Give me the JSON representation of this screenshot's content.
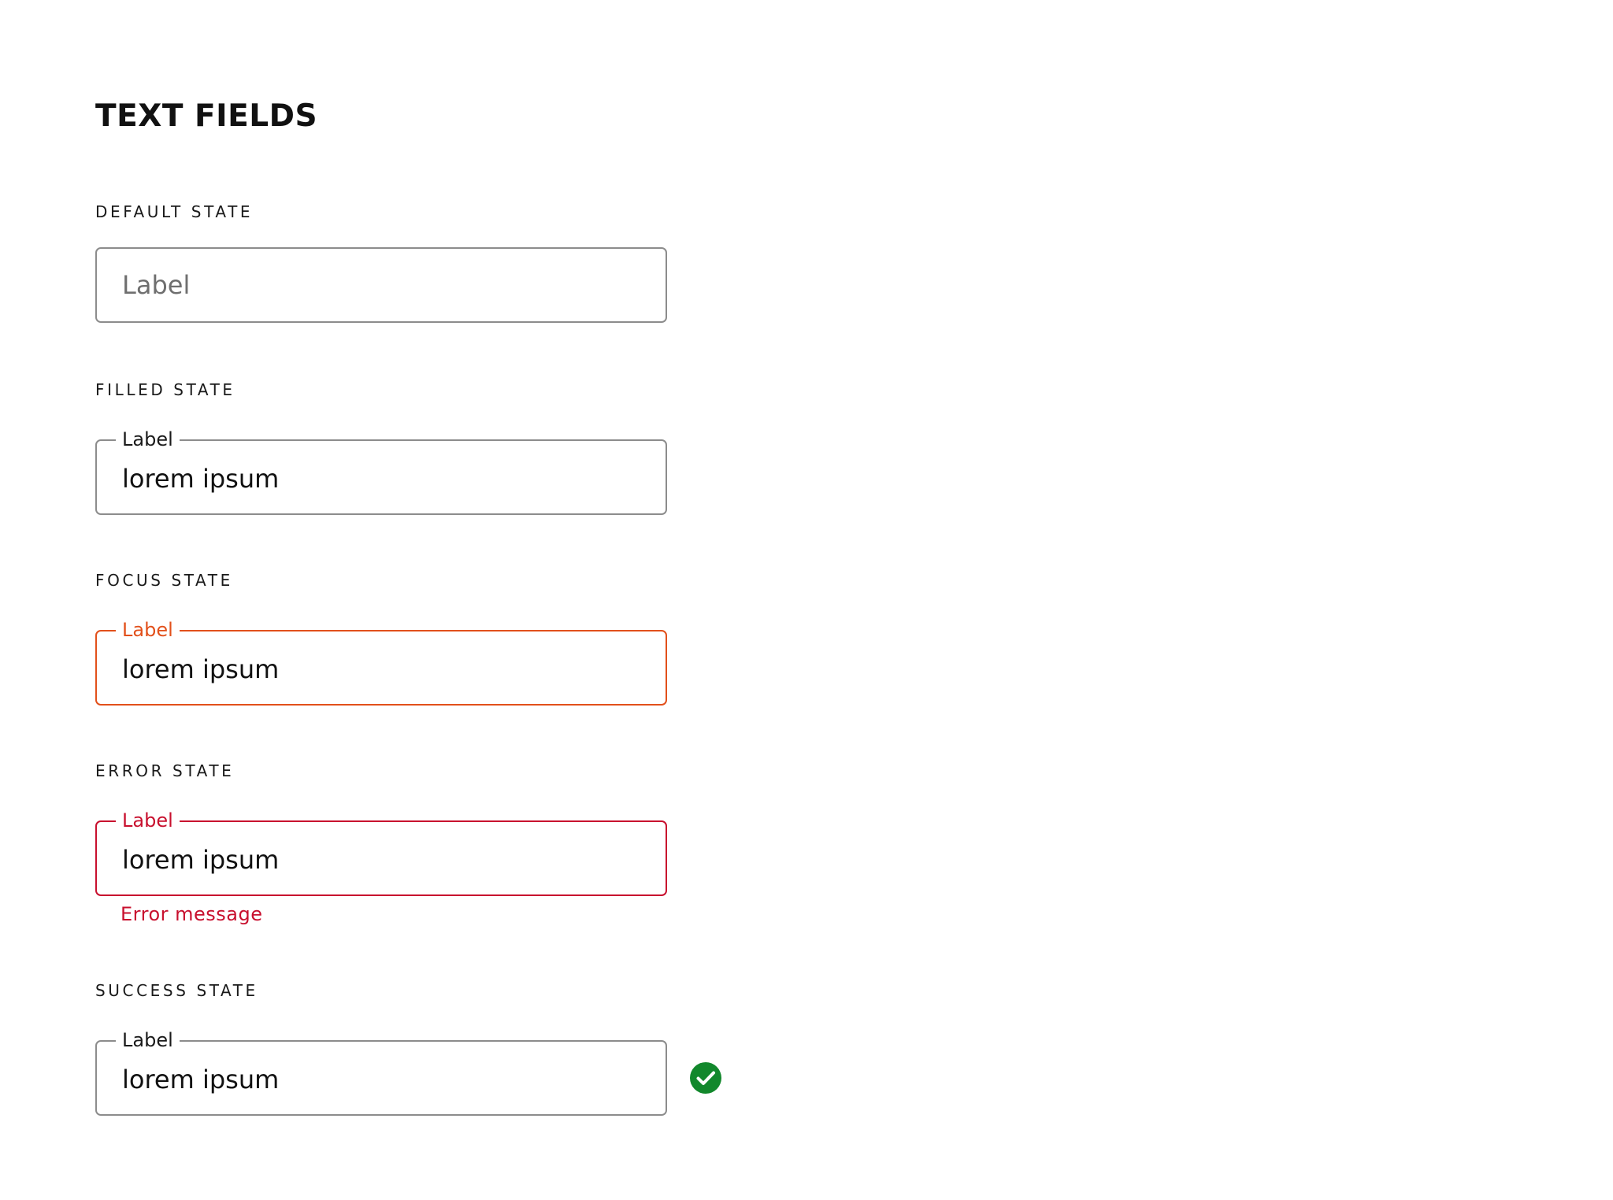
{
  "page": {
    "title": "TEXT FIELDS"
  },
  "sections": {
    "default": {
      "heading": "DEFAULT STATE",
      "placeholder": "Label"
    },
    "filled": {
      "heading": "FILLED STATE",
      "label": "Label",
      "value": "lorem ipsum"
    },
    "focus": {
      "heading": "FOCUS STATE",
      "label": "Label",
      "value": "lorem ipsum"
    },
    "error": {
      "heading": "ERROR STATE",
      "label": "Label",
      "value": "lorem ipsum",
      "message": "Error message"
    },
    "success": {
      "heading": "SUCCESS STATE",
      "label": "Label",
      "value": "lorem ipsum",
      "icon": "check-circle-icon"
    }
  },
  "colors": {
    "border_default": "#8c8c8c",
    "focus": "#e2501b",
    "error": "#c8102e",
    "success": "#12882c",
    "placeholder": "#6f6f6f"
  }
}
